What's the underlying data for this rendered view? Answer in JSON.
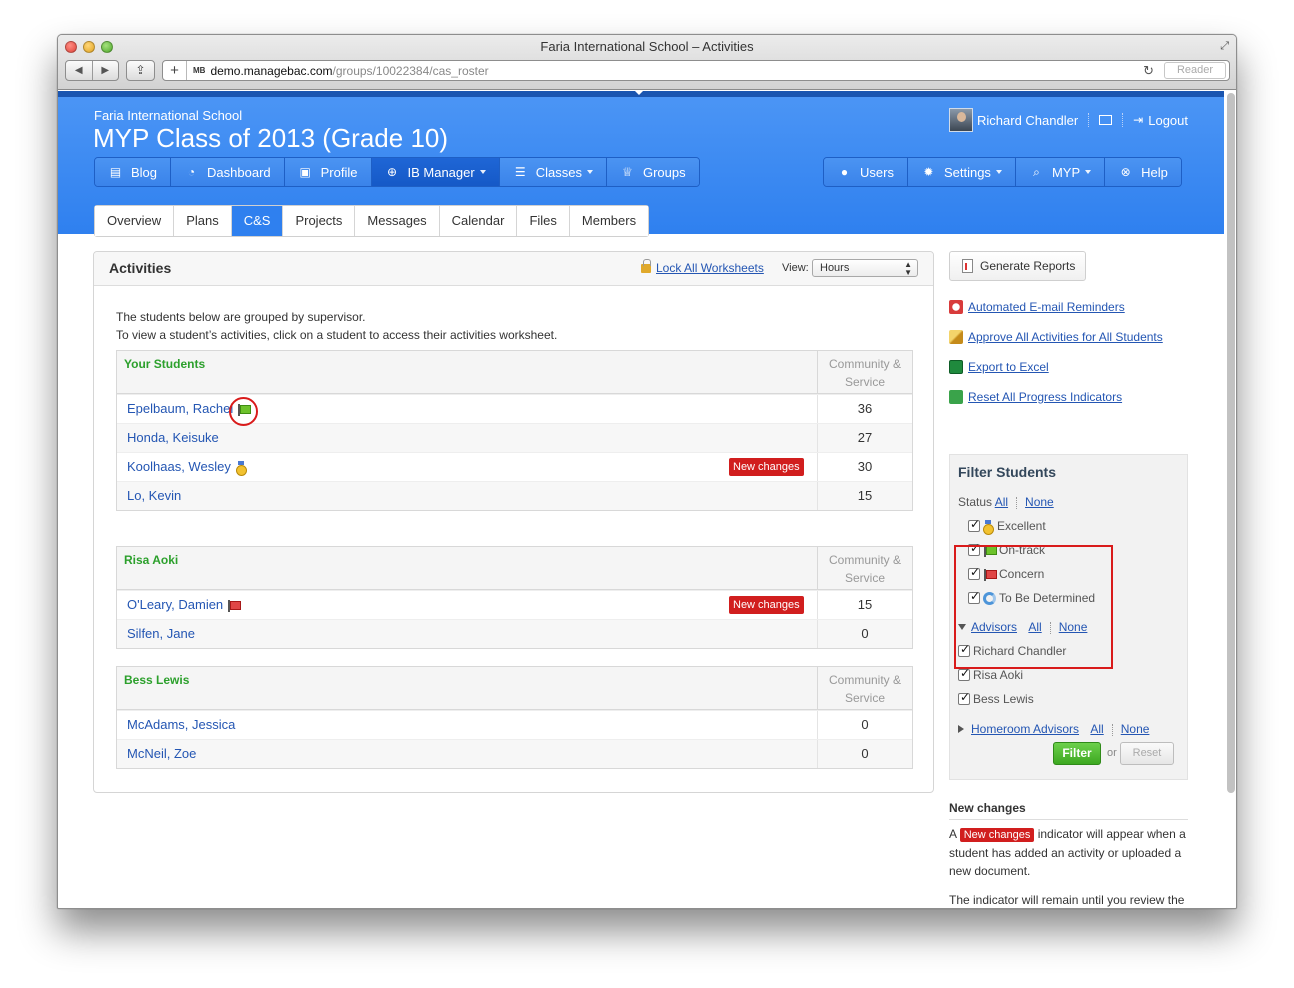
{
  "window": {
    "title": "Faria International School – Activities",
    "url_host": "demo.managebac.com",
    "url_path": "/groups/10022384/cas_roster",
    "favicon_text": "MB",
    "reader_label": "Reader"
  },
  "header": {
    "school": "Faria International School",
    "class_title": "MYP Class of 2013 (Grade 10)",
    "user_name": "Richard Chandler",
    "logout_label": "Logout"
  },
  "main_nav": [
    {
      "label": "Blog",
      "icon": "blog-icon"
    },
    {
      "label": "Dashboard",
      "icon": "dashboard-icon"
    },
    {
      "label": "Profile",
      "icon": "profile-icon"
    },
    {
      "label": "IB Manager",
      "icon": "globe-icon",
      "dropdown": true,
      "active": true
    },
    {
      "label": "Classes",
      "icon": "classes-icon",
      "dropdown": true
    },
    {
      "label": "Groups",
      "icon": "trophy-icon"
    }
  ],
  "right_nav": [
    {
      "label": "Users",
      "icon": "user-icon"
    },
    {
      "label": "Settings",
      "icon": "gear-icon",
      "dropdown": true
    },
    {
      "label": "MYP",
      "icon": "search-icon",
      "dropdown": true
    },
    {
      "label": "Help",
      "icon": "lifebuoy-icon"
    }
  ],
  "tabs": [
    "Overview",
    "Plans",
    "C&S",
    "Projects",
    "Messages",
    "Calendar",
    "Files",
    "Members"
  ],
  "active_tab": "C&S",
  "activities": {
    "title": "Activities",
    "lock_all": "Lock All Worksheets",
    "view_label": "View:",
    "view_value": "Hours",
    "intro_line1": "The students below are grouped by supervisor.",
    "intro_line2": "To view a student’s activities, click on a student to access their activities worksheet.",
    "column_header_line1": "Community &",
    "column_header_line2": "Service",
    "new_changes_badge": "New changes",
    "groups": [
      {
        "supervisor": "Your Students",
        "students": [
          {
            "name": "Epelbaum, Rachel",
            "status": "on-track",
            "value": "36",
            "new_changes": false
          },
          {
            "name": "Honda, Keisuke",
            "status": "",
            "value": "27",
            "new_changes": false
          },
          {
            "name": "Koolhaas, Wesley",
            "status": "excellent",
            "value": "30",
            "new_changes": true
          },
          {
            "name": "Lo, Kevin",
            "status": "",
            "value": "15",
            "new_changes": false
          }
        ]
      },
      {
        "supervisor": "Risa Aoki",
        "students": [
          {
            "name": "O'Leary, Damien",
            "status": "concern",
            "value": "15",
            "new_changes": true
          },
          {
            "name": "Silfen, Jane",
            "status": "",
            "value": "0",
            "new_changes": false
          }
        ]
      },
      {
        "supervisor": "Bess Lewis",
        "students": [
          {
            "name": "McAdams, Jessica",
            "status": "",
            "value": "0",
            "new_changes": false
          },
          {
            "name": "McNeil, Zoe",
            "status": "",
            "value": "0",
            "new_changes": false
          }
        ]
      }
    ]
  },
  "sidebar": {
    "generate_reports": "Generate Reports",
    "links": [
      {
        "label": "Automated E-mail Reminders",
        "icon": "alarm-clock-icon"
      },
      {
        "label": "Approve All Activities for All Students",
        "icon": "pencil-icon"
      },
      {
        "label": "Export to Excel",
        "icon": "excel-icon"
      },
      {
        "label": "Reset All Progress Indicators",
        "icon": "reset-arrow-icon"
      }
    ],
    "filter": {
      "title": "Filter Students",
      "status_label": "Status",
      "all": "All",
      "none": "None",
      "statuses": [
        {
          "label": "Excellent",
          "icon": "medal-icon",
          "checked": true
        },
        {
          "label": "On-track",
          "icon": "green-flag-icon",
          "checked": true
        },
        {
          "label": "Concern",
          "icon": "red-flag-icon",
          "checked": true
        },
        {
          "label": "To Be Determined",
          "icon": "cycle-icon",
          "checked": true
        }
      ],
      "advisors_label": "Advisors",
      "advisors": [
        "Richard Chandler",
        "Risa Aoki",
        "Bess Lewis"
      ],
      "homeroom_label": "Homeroom Advisors",
      "filter_button": "Filter",
      "or_text": "or",
      "reset_button": "Reset"
    },
    "new_changes": {
      "title": "New changes",
      "text_prefix": "A",
      "badge": "New changes",
      "text_suffix": "indicator will appear when a student has added an activity or uploaded a new document.",
      "paragraph2": "The indicator will remain until you review the student or as long as the student has activities requiring approval."
    }
  },
  "colors": {
    "header_blue": "#2f80ef",
    "supervisor_green": "#2ca02c",
    "badge_red": "#d11e1e",
    "link_blue": "#2456b3",
    "highlight_red": "#d91b1b"
  }
}
